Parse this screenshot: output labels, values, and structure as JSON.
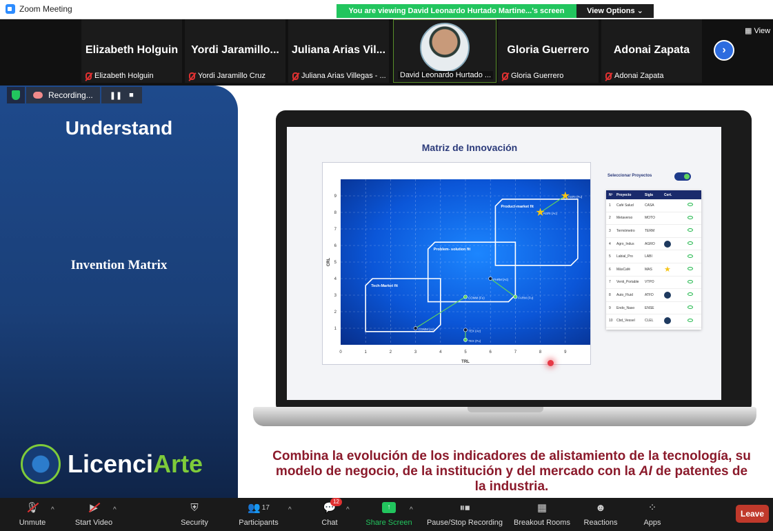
{
  "window": {
    "app_title": "Zoom Meeting"
  },
  "banner": {
    "viewing_text": "You are viewing David Leonardo Hurtado Martine...'s screen",
    "view_options": "View Options"
  },
  "gallery": {
    "view_label": "View",
    "participants": [
      {
        "display": "Elizabeth Holguin",
        "label": "Elizabeth Holguin",
        "muted": true
      },
      {
        "display": "Yordi Jaramillo...",
        "label": "Yordi Jaramillo Cruz",
        "muted": true
      },
      {
        "display": "Juliana Arias Vil...",
        "label": "Juliana Arias Villegas - ...",
        "muted": true
      },
      {
        "display": "",
        "label": "David Leonardo Hurtado ...",
        "muted": false,
        "active_speaker": true
      },
      {
        "display": "Gloria Guerrero",
        "label": "Gloria Guerrero",
        "muted": true
      },
      {
        "display": "Adonai Zapata",
        "label": "Adonai Zapata",
        "muted": true
      }
    ]
  },
  "recording": {
    "label": "Recording..."
  },
  "slide": {
    "title": "Understand",
    "subtitle": "Invention Matrix",
    "logo_part1": "Licenci",
    "logo_part2": "Arte",
    "matrix_title": "Matriz de Innovación",
    "select_projects": "Seleccionar Proyectos",
    "table_headers": [
      "Nº",
      "Proyecto",
      "Sigla",
      "Cert."
    ],
    "projects": [
      {
        "n": "1",
        "name": "Café Salud",
        "sigla": "CASA",
        "cert": ""
      },
      {
        "n": "2",
        "name": "Metaverso",
        "sigla": "MOTO",
        "cert": ""
      },
      {
        "n": "3",
        "name": "Termómetro",
        "sigla": "TERM",
        "cert": ""
      },
      {
        "n": "4",
        "name": "Agro_Indus",
        "sigla": "AGRO",
        "cert": "badge"
      },
      {
        "n": "5",
        "name": "Labial_Pro",
        "sigla": "LABI",
        "cert": ""
      },
      {
        "n": "6",
        "name": "MásCafé",
        "sigla": "MAS",
        "cert": "star"
      },
      {
        "n": "7",
        "name": "Venti_Portable",
        "sigla": "VTPO",
        "cert": ""
      },
      {
        "n": "8",
        "name": "Auto_Fluid",
        "sigla": "ATFD",
        "cert": "badge"
      },
      {
        "n": "9",
        "name": "Endo_Naso",
        "sigla": "ENSE",
        "cert": ""
      },
      {
        "n": "10",
        "name": "Cbd_Vessel",
        "sigla": "CLEL",
        "cert": "badge"
      }
    ],
    "caption_line1": "Combina la evolución de los indicadores de alistamiento de la tecnología, su",
    "caption_line2_a": "modelo de negocio, de la institución y del mercado con la ",
    "caption_line2_ai": "AI",
    "caption_line2_b": " de patentes de",
    "caption_line3": "la industria."
  },
  "chart_data": {
    "type": "scatter",
    "title": "Matriz de Innovación",
    "xlabel": "TRL",
    "ylabel": "CRL",
    "xlim": [
      0,
      10
    ],
    "ylim": [
      0,
      10
    ],
    "x_ticks": [
      0,
      1,
      2,
      3,
      4,
      5,
      6,
      7,
      8,
      9
    ],
    "y_ticks": [
      1,
      2,
      3,
      4,
      5,
      6,
      7,
      8,
      9
    ],
    "zones": [
      {
        "name": "Tech-Market fit",
        "x": [
          1,
          4
        ],
        "y": [
          0.8,
          4
        ]
      },
      {
        "name": "Problem- solution fit",
        "x": [
          3.5,
          7
        ],
        "y": [
          2.6,
          6.2
        ]
      },
      {
        "name": "Product-market fit",
        "x": [
          6.2,
          9.5
        ],
        "y": [
          4.8,
          8.8
        ]
      }
    ],
    "points": [
      {
        "label": "COMM (Ac)",
        "x": 3,
        "y": 1
      },
      {
        "label": "COMM (Fu)",
        "x": 5,
        "y": 2.9
      },
      {
        "label": "TEX (Ac)",
        "x": 5,
        "y": 0.9
      },
      {
        "label": "TEX (Fu)",
        "x": 5,
        "y": 0.3
      },
      {
        "label": "FARM (Ac)",
        "x": 6,
        "y": 4
      },
      {
        "label": "FARM (Fu)",
        "x": 7,
        "y": 2.9
      },
      {
        "label": "AGRI (Ac)",
        "x": 8,
        "y": 8
      },
      {
        "label": "AGRI (Fu)",
        "x": 9,
        "y": 9
      }
    ],
    "links": [
      [
        "COMM (Ac)",
        "COMM (Fu)"
      ],
      [
        "TEX (Ac)",
        "TEX (Fu)"
      ],
      [
        "FARM (Ac)",
        "FARM (Fu)"
      ],
      [
        "AGRI (Ac)",
        "AGRI (Fu)"
      ]
    ]
  },
  "toolbar": {
    "unmute": "Unmute",
    "start_video": "Start Video",
    "security": "Security",
    "participants": "Participants",
    "participants_count": "17",
    "chat": "Chat",
    "chat_badge": "12",
    "share_screen": "Share Screen",
    "pause_recording": "Pause/Stop Recording",
    "breakout_rooms": "Breakout Rooms",
    "reactions": "Reactions",
    "apps": "Apps",
    "leave": "Leave"
  },
  "colors": {
    "banner": "#22c55e",
    "slide_panel": "#1e4a8c",
    "caption": "#8b1a2b",
    "leave": "#c0392b",
    "accent_green": "#7ecb3a"
  }
}
